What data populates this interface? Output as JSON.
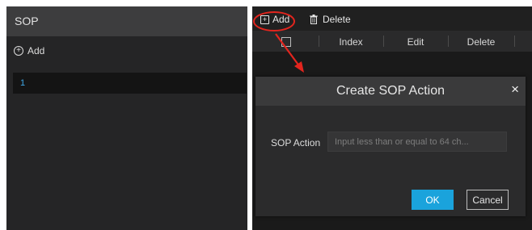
{
  "left_panel": {
    "title": "SOP",
    "add_label": "Add",
    "items": [
      {
        "label": "1",
        "selected": true
      }
    ]
  },
  "toolbar": {
    "add_label": "Add",
    "delete_label": "Delete"
  },
  "table": {
    "columns": [
      "Index",
      "Edit",
      "Delete"
    ]
  },
  "modal": {
    "title": "Create SOP Action",
    "close_glyph": "×",
    "field_label": "SOP Action",
    "field_placeholder": "Input less than or equal to 64 ch...",
    "field_value": "",
    "ok_label": "OK",
    "cancel_label": "Cancel"
  },
  "icons": {
    "left_add": "plus-circle-icon",
    "toolbar_add": "plus-square-icon",
    "toolbar_delete": "trash-icon",
    "modal_close": "close-icon"
  },
  "colors": {
    "accent": "#1aa3dc",
    "selected_text": "#3fa9e8",
    "annotation_red": "#e3251e"
  }
}
